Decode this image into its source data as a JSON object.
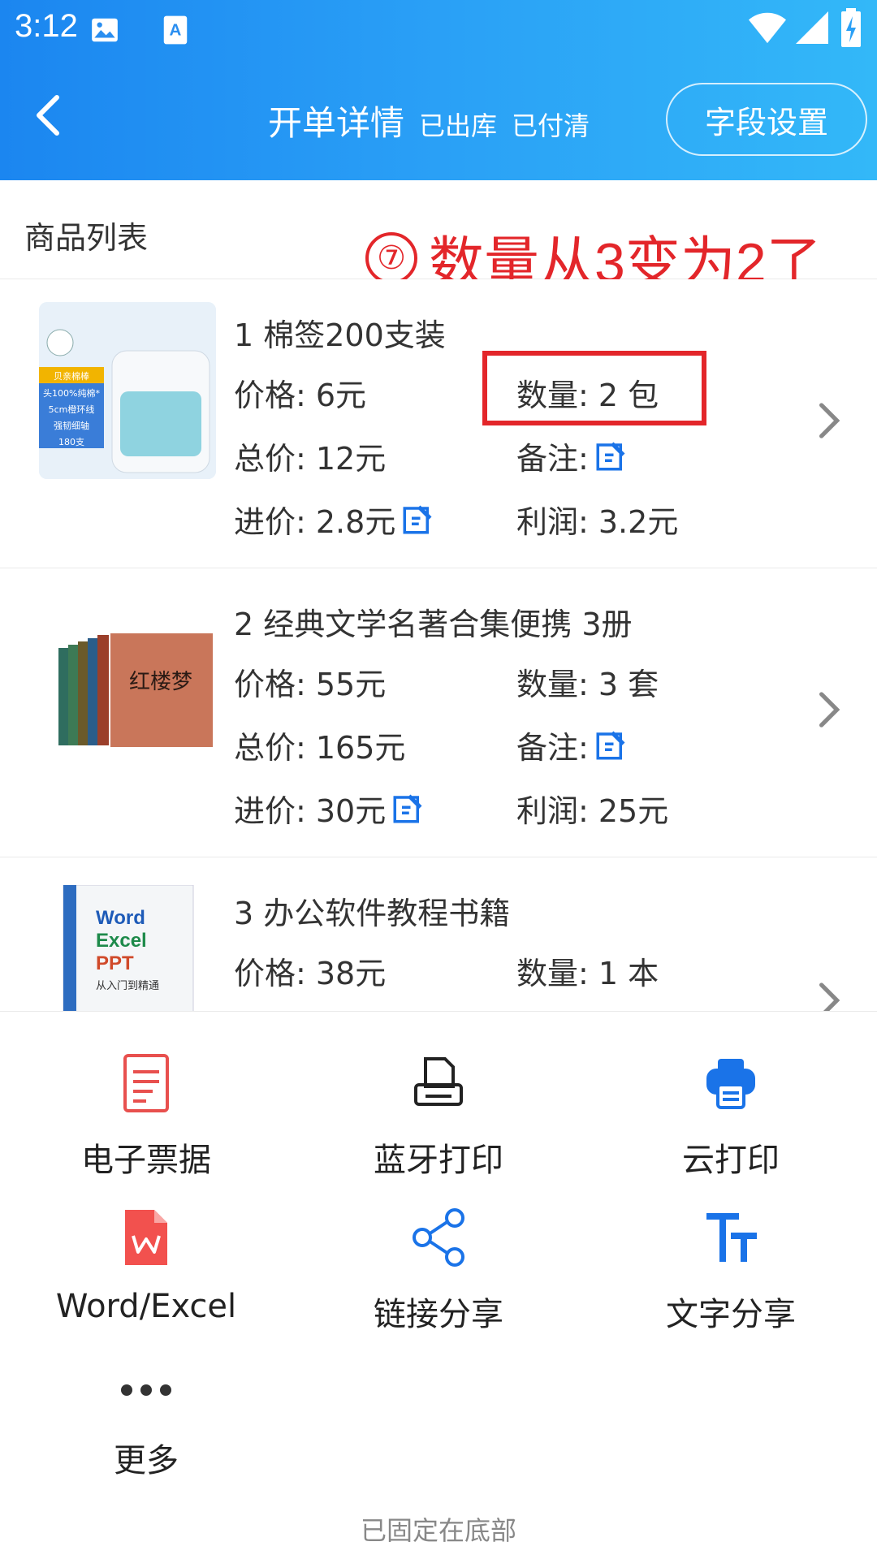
{
  "status_bar": {
    "time": "3:12"
  },
  "navbar": {
    "title": "开单详情",
    "status1": "已出库",
    "status2": "已付清",
    "field_settings": "字段设置"
  },
  "list": {
    "title": "商品列表"
  },
  "note": {
    "circle": "⑦",
    "text": "数量从3变为2了"
  },
  "items": [
    {
      "name": "1 棉签200支装",
      "price": "价格: 6元",
      "qty": "数量: 2 包",
      "total": "总价: 12元",
      "remark": "备注:",
      "cost": "进价: 2.8元",
      "profit": "利润: 3.2元"
    },
    {
      "name": "2 经典文学名著合集便携 3册",
      "price": "价格: 55元",
      "qty": "数量: 3 套",
      "total": "总价: 165元",
      "remark": "备注:",
      "cost": "进价: 30元",
      "profit": "利润: 25元"
    },
    {
      "name": "3 办公软件教程书籍",
      "price": "价格: 38元",
      "qty": "数量: 1 本"
    }
  ],
  "thumb_text": {
    "item1": [
      "贝亲棉棒",
      "头100%纯棉*",
      "5cm橙环线",
      "强韧细轴",
      "180支"
    ],
    "item2": "红楼梦",
    "item3": [
      "Word",
      "Excel",
      "PPT",
      "从入门到精通"
    ]
  },
  "actions": [
    {
      "label": "电子票据",
      "icon": "receipt-icon"
    },
    {
      "label": "蓝牙打印",
      "icon": "bluetooth-printer-icon"
    },
    {
      "label": "云打印",
      "icon": "cloud-print-icon"
    },
    {
      "label": "Word/Excel",
      "icon": "wps-doc-icon"
    },
    {
      "label": "链接分享",
      "icon": "share-icon"
    },
    {
      "label": "文字分享",
      "icon": "text-share-icon"
    },
    {
      "label": "更多",
      "icon": "more-icon"
    }
  ],
  "footer": {
    "text": "已固定在底部"
  },
  "colors": {
    "header_start": "#1b86f0",
    "header_end": "#33b8f8",
    "accent_blue": "#1a73e8",
    "annotation_red": "#e3262a",
    "receipt_red": "#e8504e"
  }
}
